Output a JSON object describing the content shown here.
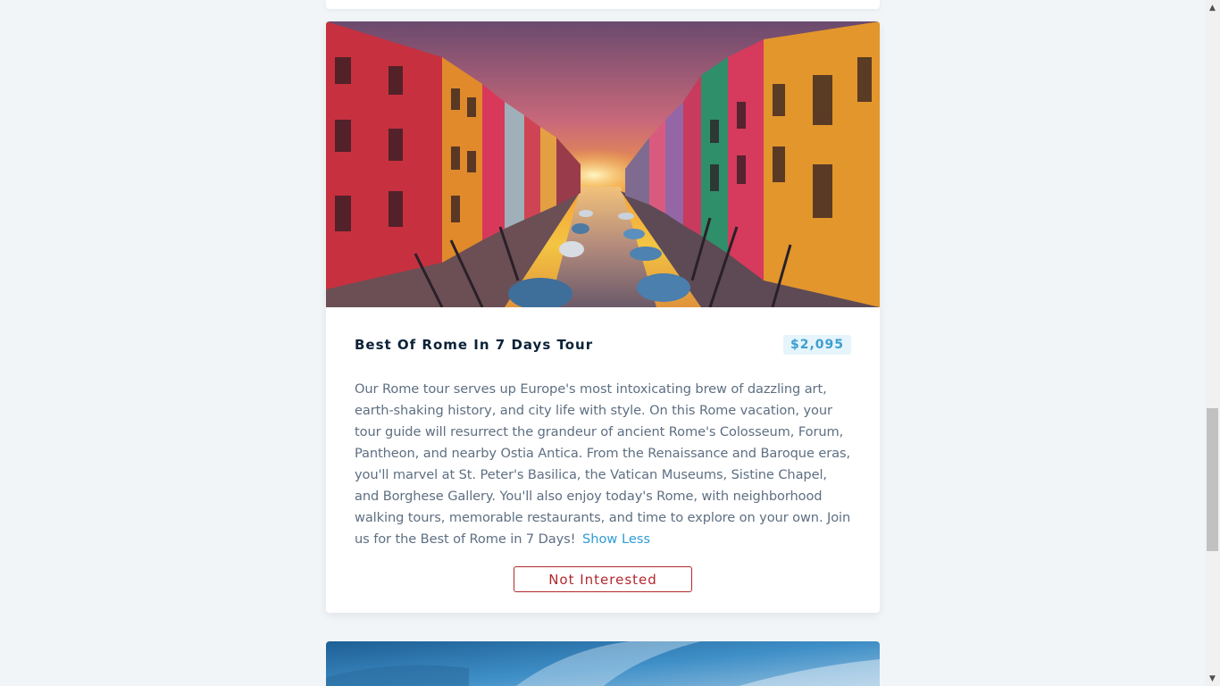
{
  "tour": {
    "title": "Best Of Rome In 7 Days Tour",
    "price": "$2,095",
    "description": "Our Rome tour serves up Europe's most intoxicating brew of dazzling art, earth-shaking history, and city life with style. On this Rome vacation, your tour guide will resurrect the grandeur of ancient Rome's Colosseum, Forum, Pantheon, and nearby Ostia Antica. From the Renaissance and Baroque eras, you'll marvel at St. Peter's Basilica, the Vatican Museums, Sistine Chapel, and Borghese Gallery. You'll also enjoy today's Rome, with neighborhood walking tours, memorable restaurants, and time to explore on your own. Join us for the Best of Rome in 7 Days!",
    "toggle_label": "Show Less",
    "dismiss_label": "Not Interested"
  },
  "scrollbar": {
    "up_icon": "▲",
    "down_icon": "▼",
    "position": 0.55
  },
  "colors": {
    "page_background": "#f1f5f8",
    "title": "#0b2238",
    "price_text": "#3d9ecf",
    "price_background": "#e6f4fb",
    "link": "#2f9bd6",
    "danger": "#b3282d",
    "body_text": "#5e6f82"
  },
  "icons": {
    "tour_image": "canal-sunset-photo",
    "next_tour_image": "sky-photo"
  }
}
